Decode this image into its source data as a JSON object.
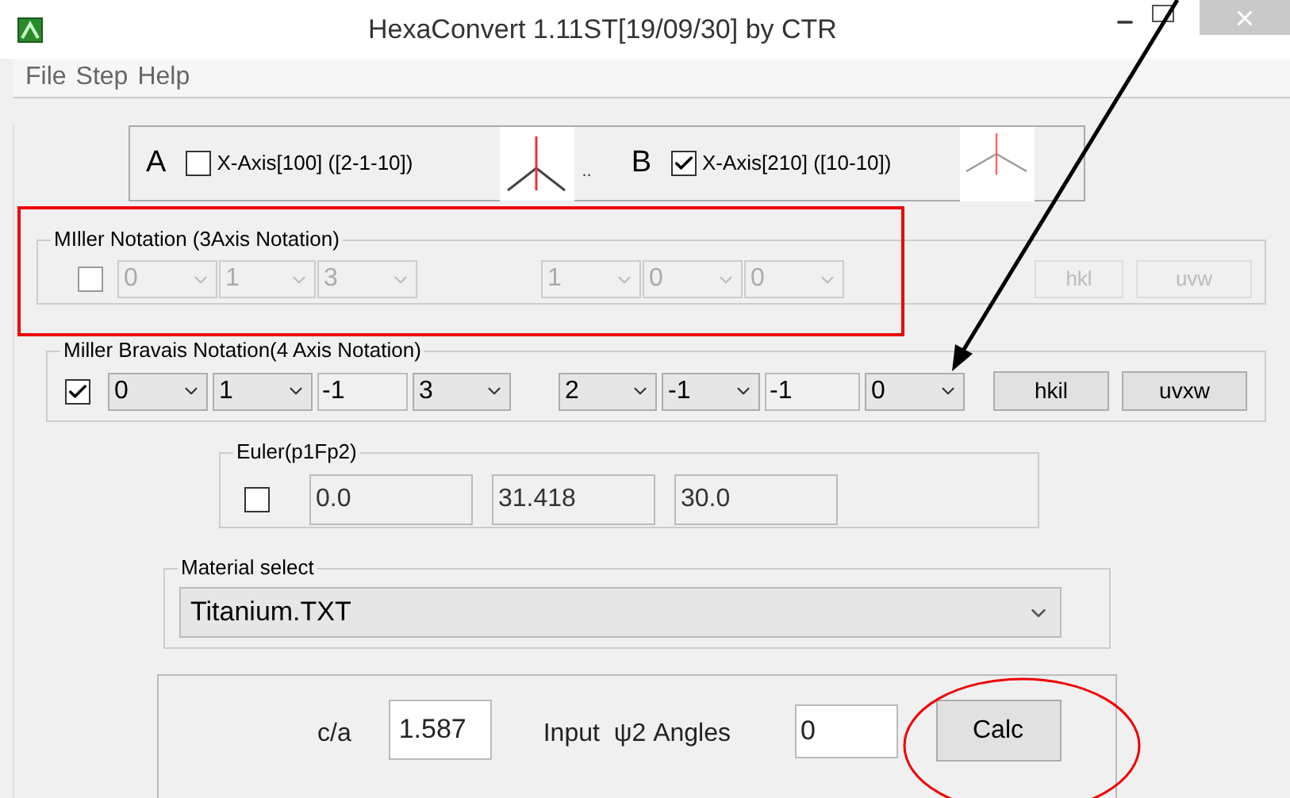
{
  "window": {
    "title": "HexaConvert 1.11ST[19/09/30] by CTR"
  },
  "menu": [
    {
      "label": "File"
    },
    {
      "label": "Step"
    },
    {
      "label": "Help"
    }
  ],
  "axis_panel": {
    "a": {
      "letter": "A",
      "label": "X-Axis[100] ([2-1-10])",
      "checked": false,
      "kind": "y"
    },
    "separator": "..",
    "b": {
      "letter": "B",
      "label": "X-Axis[210] ([10-10])",
      "checked": true,
      "kind": "roof"
    }
  },
  "miller": {
    "legend": "MIller Notation (3Axis Notation)",
    "checked": false,
    "disabled": true,
    "fields": [
      {
        "kind": "select",
        "value": "0"
      },
      {
        "kind": "select",
        "value": "1"
      },
      {
        "kind": "select",
        "value": "3"
      },
      {
        "kind": "gap"
      },
      {
        "kind": "select",
        "value": "1"
      },
      {
        "kind": "select",
        "value": "0"
      },
      {
        "kind": "select",
        "value": "0"
      }
    ],
    "buttons": [
      {
        "label": "hkl"
      },
      {
        "label": "uvw"
      }
    ]
  },
  "bravais": {
    "legend": "Miller Bravais Notation(4 Axis Notation)",
    "checked": true,
    "disabled": false,
    "fields": [
      {
        "kind": "select",
        "value": "0"
      },
      {
        "kind": "select",
        "value": "1"
      },
      {
        "kind": "input",
        "value": "-1"
      },
      {
        "kind": "select",
        "value": "3"
      },
      {
        "kind": "gap"
      },
      {
        "kind": "select",
        "value": "2"
      },
      {
        "kind": "select",
        "value": "-1"
      },
      {
        "kind": "input",
        "value": "-1"
      },
      {
        "kind": "select",
        "value": "0"
      }
    ],
    "buttons": [
      {
        "label": "hkil"
      },
      {
        "label": "uvxw"
      }
    ]
  },
  "euler": {
    "legend": "Euler(p1Fp2)",
    "checked": false,
    "values": [
      "0.0",
      "31.418",
      "30.0"
    ]
  },
  "material": {
    "legend": "Material select",
    "value": "Titanium.TXT"
  },
  "bottom": {
    "ca_label": "c/a",
    "ca_value": "1.587",
    "angles_label": "Input  ψ2 Angles",
    "angles_value": "0",
    "button": "Calc"
  },
  "annotations": [
    {
      "kind": "box"
    },
    {
      "kind": "ellipse"
    },
    {
      "kind": "arrow"
    }
  ]
}
